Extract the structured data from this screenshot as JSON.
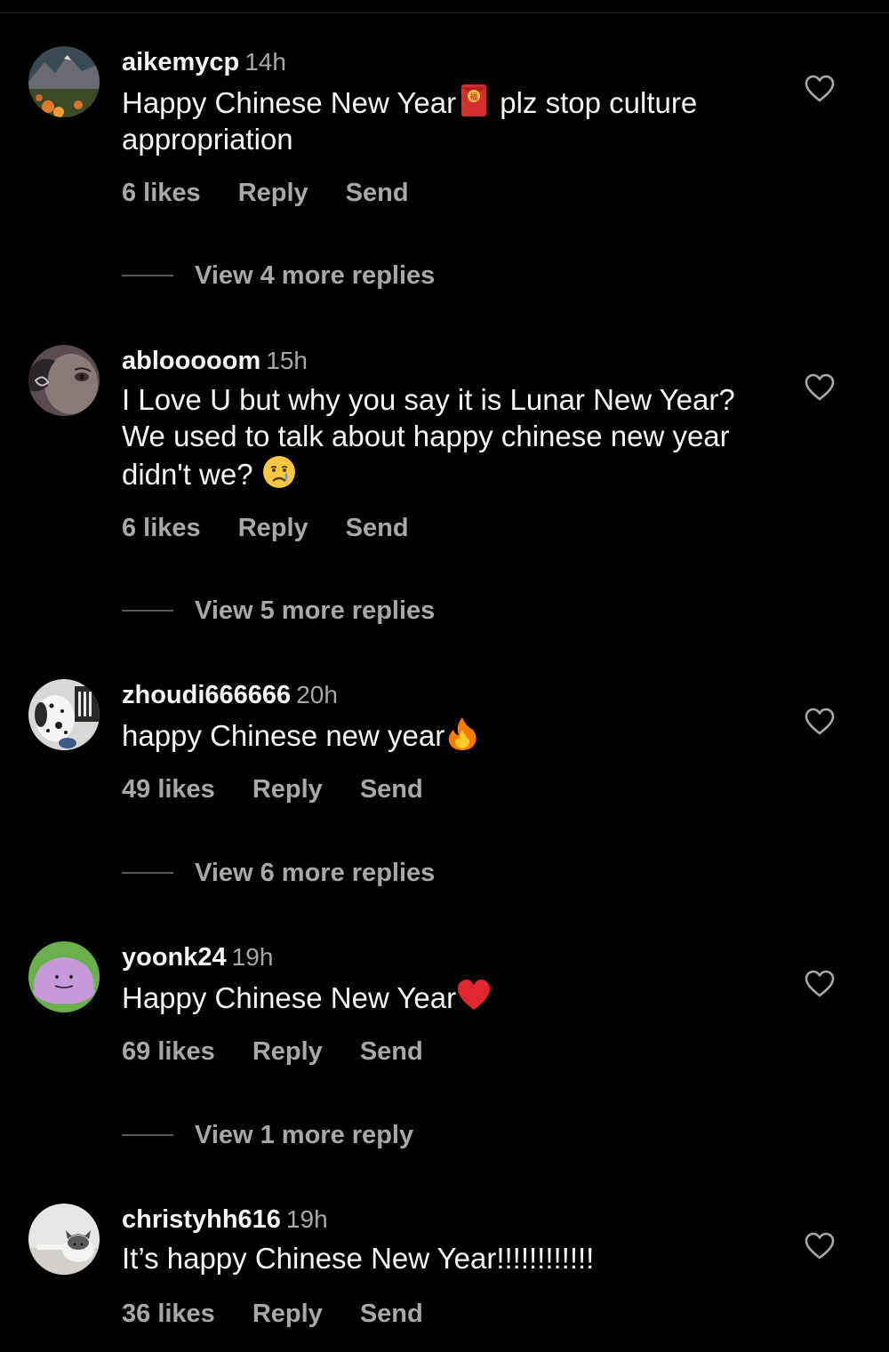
{
  "comments": [
    {
      "username": "aikemycp",
      "time": "14h",
      "text_before": "Happy Chinese New Year",
      "emoji": "red-envelope",
      "text_after": " plz stop culture appropriation",
      "likes": "6 likes",
      "reply": "Reply",
      "send": "Send",
      "view_replies": "View 4 more replies",
      "avatar": "landscape-flowers-avatar"
    },
    {
      "username": "ablooooom",
      "time": "15h",
      "text_before": "I Love U but why you say it is Lunar New Year?  We used to talk about happy chinese new year didn't we?  ",
      "emoji": "crying-face",
      "text_after": "",
      "likes": "6 likes",
      "reply": "Reply",
      "send": "Send",
      "view_replies": "View 5 more replies",
      "avatar": "illustrated-face-avatar"
    },
    {
      "username": "zhoudi666666",
      "time": "20h",
      "text_before": "happy Chinese new year",
      "emoji": "fire",
      "text_after": "",
      "likes": "49 likes",
      "reply": "Reply",
      "send": "Send",
      "view_replies": "View 6 more replies",
      "avatar": "dalmatian-avatar"
    },
    {
      "username": "yoonk24",
      "time": "19h",
      "text_before": "Happy Chinese New Year",
      "emoji": "red-heart",
      "text_after": "",
      "likes": "69 likes",
      "reply": "Reply",
      "send": "Send",
      "view_replies": "View 1 more reply",
      "avatar": "ditto-avatar"
    },
    {
      "username": "christyhh616",
      "time": "19h",
      "text_before": "It’s happy Chinese New Year!!!!!!!!!!!!",
      "emoji": "",
      "text_after": "",
      "likes": "36 likes",
      "reply": "Reply",
      "send": "Send",
      "view_replies": "",
      "avatar": "cat-avatar"
    }
  ],
  "icons": {
    "like": "heart-outline-icon"
  },
  "colors": {
    "background": "#000000",
    "primary_text": "#f5f5f5",
    "secondary_text": "#a8a8a8",
    "divider": "#595959"
  }
}
